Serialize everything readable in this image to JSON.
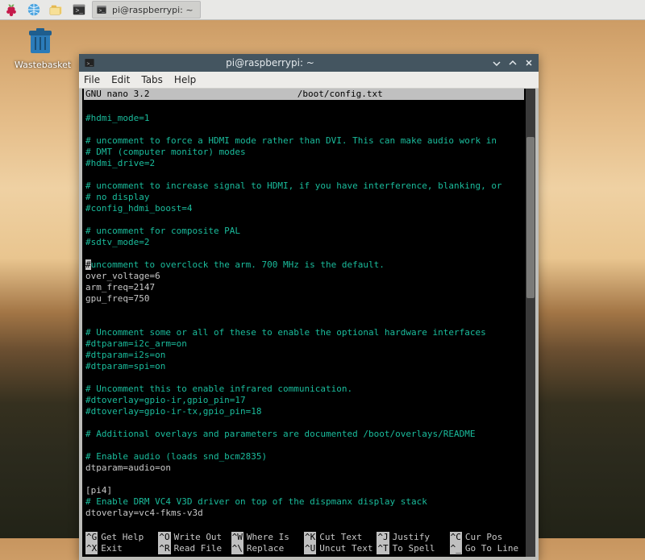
{
  "panel": {
    "taskbar_button_label": "pi@raspberrypi: ~"
  },
  "desktop": {
    "trash_label": "Wastebasket"
  },
  "window": {
    "title": "pi@raspberrypi: ~",
    "menu": {
      "file": "File",
      "edit": "Edit",
      "tabs": "Tabs",
      "help": "Help"
    }
  },
  "nano": {
    "app": "  GNU nano 3.2",
    "file": "/boot/config.txt",
    "body_lines": [
      {
        "c": "cyan",
        "t": ""
      },
      {
        "c": "cyan",
        "t": "#hdmi_mode=1"
      },
      {
        "c": "cyan",
        "t": ""
      },
      {
        "c": "cyan",
        "t": "# uncomment to force a HDMI mode rather than DVI. This can make audio work in"
      },
      {
        "c": "cyan",
        "t": "# DMT (computer monitor) modes"
      },
      {
        "c": "cyan",
        "t": "#hdmi_drive=2"
      },
      {
        "c": "cyan",
        "t": ""
      },
      {
        "c": "cyan",
        "t": "# uncomment to increase signal to HDMI, if you have interference, blanking, or"
      },
      {
        "c": "cyan",
        "t": "# no display"
      },
      {
        "c": "cyan",
        "t": "#config_hdmi_boost=4"
      },
      {
        "c": "cyan",
        "t": ""
      },
      {
        "c": "cyan",
        "t": "# uncomment for composite PAL"
      },
      {
        "c": "cyan",
        "t": "#sdtv_mode=2"
      },
      {
        "c": "cyan",
        "t": ""
      },
      {
        "cursor": true,
        "pre": "#",
        "rest": "uncomment to overclock the arm. 700 MHz is the default."
      },
      {
        "c": "white",
        "t": "over_voltage=6"
      },
      {
        "c": "white",
        "t": "arm_freq=2147"
      },
      {
        "c": "white",
        "t": "gpu_freq=750"
      },
      {
        "c": "cyan",
        "t": ""
      },
      {
        "c": "cyan",
        "t": ""
      },
      {
        "c": "cyan",
        "t": "# Uncomment some or all of these to enable the optional hardware interfaces"
      },
      {
        "c": "cyan",
        "t": "#dtparam=i2c_arm=on"
      },
      {
        "c": "cyan",
        "t": "#dtparam=i2s=on"
      },
      {
        "c": "cyan",
        "t": "#dtparam=spi=on"
      },
      {
        "c": "cyan",
        "t": ""
      },
      {
        "c": "cyan",
        "t": "# Uncomment this to enable infrared communication."
      },
      {
        "c": "cyan",
        "t": "#dtoverlay=gpio-ir,gpio_pin=17"
      },
      {
        "c": "cyan",
        "t": "#dtoverlay=gpio-ir-tx,gpio_pin=18"
      },
      {
        "c": "cyan",
        "t": ""
      },
      {
        "c": "cyan",
        "t": "# Additional overlays and parameters are documented /boot/overlays/README"
      },
      {
        "c": "cyan",
        "t": ""
      },
      {
        "c": "cyan",
        "t": "# Enable audio (loads snd_bcm2835)"
      },
      {
        "c": "white",
        "t": "dtparam=audio=on"
      },
      {
        "c": "white",
        "t": ""
      },
      {
        "c": "white",
        "t": "[pi4]"
      },
      {
        "c": "cyan",
        "t": "# Enable DRM VC4 V3D driver on top of the dispmanx display stack"
      },
      {
        "c": "white",
        "t": "dtoverlay=vc4-fkms-v3d"
      },
      {
        "c": "white",
        "t": ""
      }
    ],
    "shortcuts": [
      {
        "k": "^G",
        "l": "Get Help"
      },
      {
        "k": "^O",
        "l": "Write Out"
      },
      {
        "k": "^W",
        "l": "Where Is"
      },
      {
        "k": "^K",
        "l": "Cut Text"
      },
      {
        "k": "^J",
        "l": "Justify"
      },
      {
        "k": "^C",
        "l": "Cur Pos"
      },
      {
        "k": "^X",
        "l": "Exit"
      },
      {
        "k": "^R",
        "l": "Read File"
      },
      {
        "k": "^\\",
        "l": "Replace"
      },
      {
        "k": "^U",
        "l": "Uncut Text"
      },
      {
        "k": "^T",
        "l": "To Spell"
      },
      {
        "k": "^_",
        "l": "Go To Line"
      }
    ]
  }
}
